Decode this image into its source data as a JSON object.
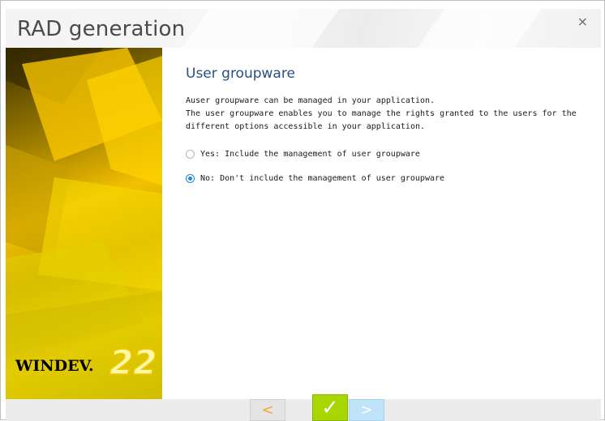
{
  "window": {
    "title": "RAD generation",
    "close_glyph": "×"
  },
  "sidebar": {
    "logo_text": "WINDEV.",
    "logo_version": "22"
  },
  "main": {
    "heading": "User groupware",
    "description": [
      "Auser groupware can be managed in your application.",
      "The user groupware enables you to manage the rights granted to the users for the different options accessible in your application."
    ],
    "options": [
      {
        "label": "Yes: Include the management of user groupware",
        "selected": false
      },
      {
        "label": "No: Don't include the management of user groupware",
        "selected": true
      }
    ]
  },
  "footer": {
    "prev_glyph": "<",
    "ok_glyph": "✓",
    "next_glyph": ">",
    "colors": {
      "prev": "#f2a33a",
      "ok": "#ffffff",
      "next": "#ffffff"
    }
  }
}
